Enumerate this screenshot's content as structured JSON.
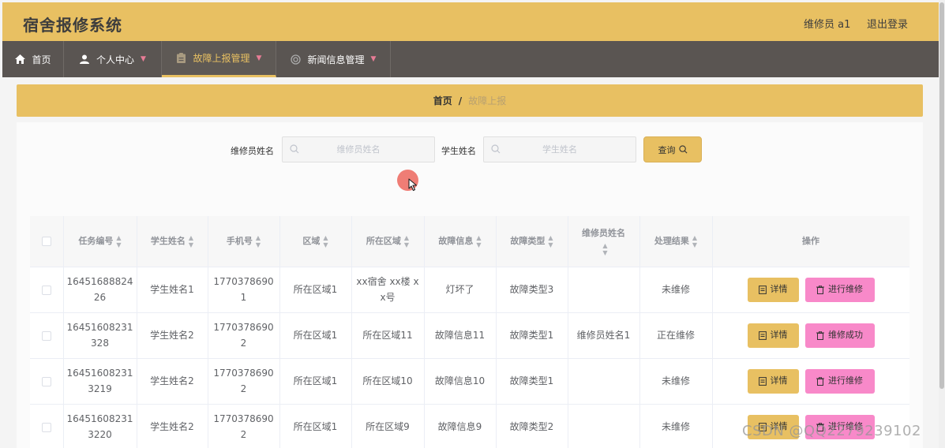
{
  "header": {
    "title": "宿舍报修系统",
    "user": "维修员 a1",
    "logout": "退出登录"
  },
  "nav": [
    {
      "label": "首页",
      "icon": "home-icon",
      "caret": false
    },
    {
      "label": "个人中心",
      "icon": "user-icon",
      "caret": true
    },
    {
      "label": "故障上报管理",
      "icon": "clipboard-icon",
      "caret": true
    },
    {
      "label": "新闻信息管理",
      "icon": "news-icon",
      "caret": true
    }
  ],
  "breadcrumb": {
    "home": "首页",
    "separator": "/",
    "current": "故障上报"
  },
  "search": {
    "repair_label": "维修员姓名",
    "repair_placeholder": "维修员姓名",
    "student_label": "学生姓名",
    "student_placeholder": "学生姓名",
    "query": "查询"
  },
  "table": {
    "headers": [
      "任务编号",
      "学生姓名",
      "手机号",
      "区域",
      "所在区域",
      "故障信息",
      "故障类型",
      "维修员姓名",
      "处理结果",
      "操作"
    ],
    "rows": [
      {
        "id": "1645168882426",
        "student": "学生姓名1",
        "phone": "17703786901",
        "area": "所在区域1",
        "location": "xx宿舍 xx楼 xx号",
        "fault": "灯坏了",
        "type": "故障类型3",
        "repairer": "",
        "result": "未维修",
        "detail": "详情",
        "action": "进行维修"
      },
      {
        "id": "16451608231328",
        "student": "学生姓名2",
        "phone": "17703786902",
        "area": "所在区域1",
        "location": "所在区域11",
        "fault": "故障信息11",
        "type": "故障类型1",
        "repairer": "维修员姓名1",
        "result": "正在维修",
        "detail": "详情",
        "action": "维修成功"
      },
      {
        "id": "164516082313219",
        "student": "学生姓名2",
        "phone": "17703786902",
        "area": "所在区域1",
        "location": "所在区域10",
        "fault": "故障信息10",
        "type": "故障类型1",
        "repairer": "",
        "result": "未维修",
        "detail": "详情",
        "action": "进行维修"
      },
      {
        "id": "164516082313220",
        "student": "学生姓名2",
        "phone": "17703786902",
        "area": "所在区域1",
        "location": "所在区域9",
        "fault": "故障信息9",
        "type": "故障类型2",
        "repairer": "",
        "result": "未维修",
        "detail": "详情",
        "action": "进行维修"
      }
    ]
  },
  "watermark": "CSDN @QQ2279239102",
  "colors": {
    "primary": "#e8c062",
    "nav_bg": "#5a5552",
    "action_pink": "#f889c9",
    "caret": "#e87d96"
  }
}
